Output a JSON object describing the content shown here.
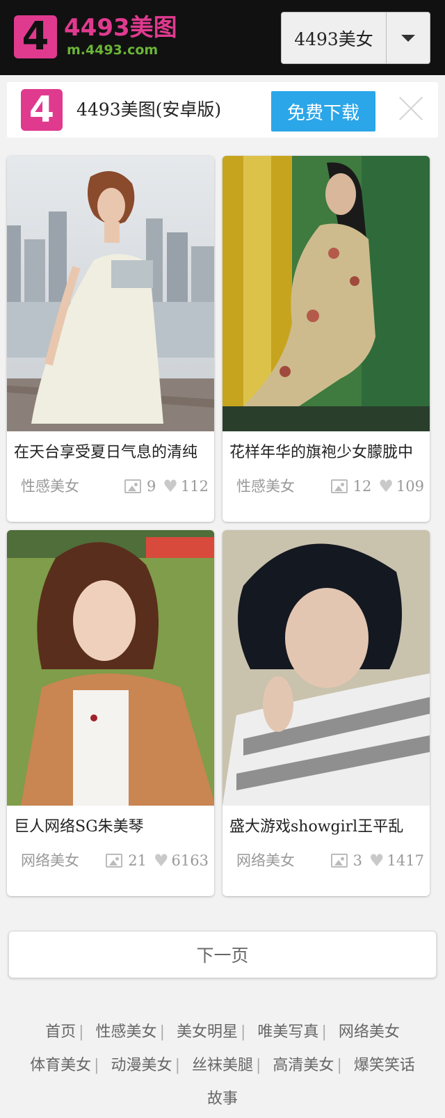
{
  "header": {
    "logo_text": "4",
    "site_name": "4493美图",
    "domain": "m.4493.com",
    "category_select": "4493美女"
  },
  "app_banner": {
    "app_icon_text": "4",
    "app_name": "4493美图(安卓版)",
    "download_label": "免费下载"
  },
  "cards": [
    {
      "title": "在天台享受夏日气息的清纯",
      "category": "性感美女",
      "photos": "9",
      "likes": "112"
    },
    {
      "title": "花样年华的旗袍少女朦胧中",
      "category": "性感美女",
      "photos": "12",
      "likes": "109"
    },
    {
      "title": "巨人网络SG朱美琴",
      "category": "网络美女",
      "photos": "21",
      "likes": "6163"
    },
    {
      "title": "盛大游戏showgirl王平乱",
      "category": "网络美女",
      "photos": "3",
      "likes": "1417"
    }
  ],
  "next_page_label": "下一页",
  "footer_links": [
    "首页",
    "性感美女",
    "美女明星",
    "唯美写真",
    "网络美女",
    "体育美女",
    "动漫美女",
    "丝袜美腿",
    "高清美女",
    "爆笑笑话",
    "故事"
  ],
  "footer_separator": "|"
}
